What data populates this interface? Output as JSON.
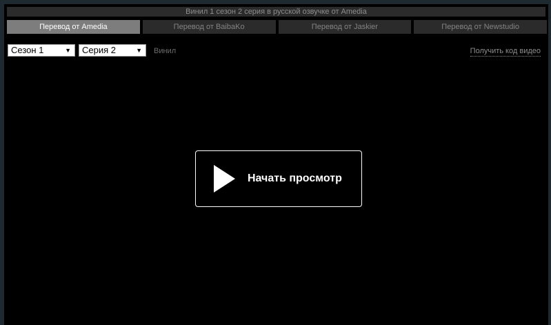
{
  "header": {
    "title": "Винил 1 сезон 2 серия в русской озвучке от Amedia"
  },
  "tabs": [
    {
      "label": "Перевод от Amedia",
      "active": true
    },
    {
      "label": "Перевод от BaibaKo",
      "active": false
    },
    {
      "label": "Перевод от Jaskier",
      "active": false
    },
    {
      "label": "Перевод от Newstudio",
      "active": false
    }
  ],
  "controls": {
    "season": "Сезон 1",
    "episode": "Серия 2",
    "caret": "▼",
    "show_name": "Винил",
    "embed_link": "Получить код видео"
  },
  "player": {
    "play_label": "Начать просмотр"
  },
  "colors": {
    "background": "#000000",
    "page": "#1e2a30",
    "tab_active": "#7d7d7d",
    "tab_inactive": "#2b2b2b"
  }
}
